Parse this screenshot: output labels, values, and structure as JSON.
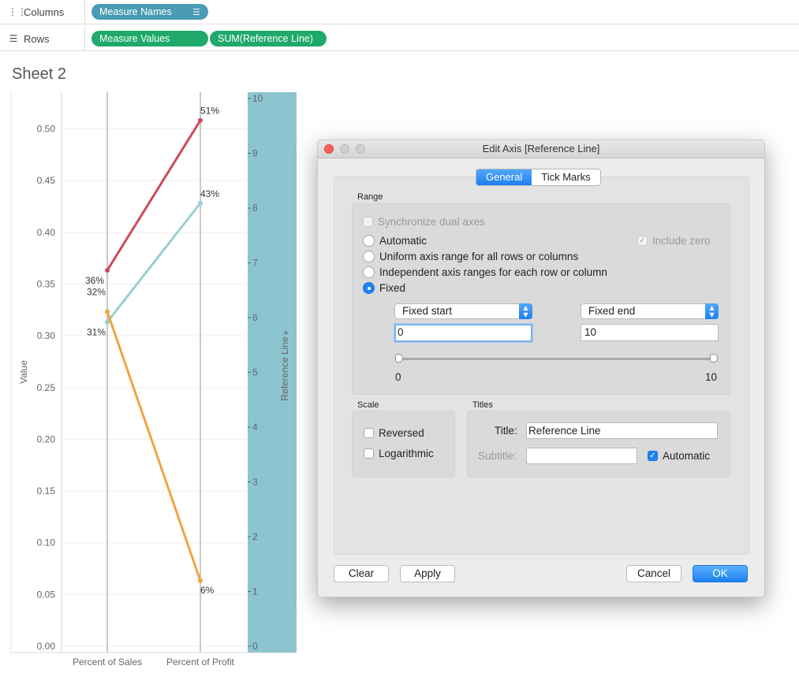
{
  "shelves": {
    "columns": {
      "label": "Columns",
      "icon": "columns-icon",
      "pills": [
        {
          "text": "Measure Names",
          "icon": "sort-icon"
        }
      ]
    },
    "rows": {
      "label": "Rows",
      "icon": "rows-icon",
      "pills": [
        {
          "text": "Measure Values"
        },
        {
          "text": "SUM(Reference Line)"
        }
      ]
    }
  },
  "sheet_title": "Sheet 2",
  "colors": {
    "pill_blue": "#4a9bb4",
    "pill_green": "#1fa96a",
    "series_red": "#d04a57",
    "series_teal": "#98cfce",
    "series_orange": "#f0a444",
    "ref_band": "#8cc4d0",
    "accent_blue": "#1f82f2"
  },
  "chart_data": {
    "type": "line",
    "categories": [
      "Percent of Sales",
      "Percent of Profit"
    ],
    "series": [
      {
        "values": [
          0.3633,
          0.5082
        ],
        "labels": [
          "36%",
          "51%"
        ],
        "color": "#d04a57"
      },
      {
        "values": [
          0.3133,
          0.4282
        ],
        "labels": [
          "31%",
          "43%"
        ],
        "color": "#98cfce"
      },
      {
        "values": [
          0.3233,
          0.0633
        ],
        "labels": [
          "32%",
          "6%"
        ],
        "color": "#f0a444"
      }
    ],
    "ylabel": "Value",
    "ylim": [
      0,
      0.5
    ],
    "yticks": [
      "0.00",
      "0.05",
      "0.10",
      "0.15",
      "0.20",
      "0.25",
      "0.30",
      "0.35",
      "0.40",
      "0.45",
      "0.50"
    ],
    "y2label": "Reference Line",
    "y2lim": [
      0,
      10
    ],
    "y2ticks": [
      "0",
      "1",
      "2",
      "3",
      "4",
      "5",
      "6",
      "7",
      "8",
      "9",
      "10"
    ],
    "grid": true
  },
  "dialog": {
    "title": "Edit Axis [Reference Line]",
    "tabs": [
      "General",
      "Tick Marks"
    ],
    "range": {
      "title": "Range",
      "sync_label": "Synchronize dual axes",
      "include_zero_label": "Include zero",
      "options": [
        "Automatic",
        "Uniform axis range for all rows or columns",
        "Independent axis ranges for each row or column",
        "Fixed"
      ],
      "selected": "Fixed",
      "fixed_start_select": "Fixed start",
      "fixed_end_select": "Fixed end",
      "start_value": "0",
      "end_value": "10",
      "slider_min_label": "0",
      "slider_max_label": "10"
    },
    "scale": {
      "title": "Scale",
      "reversed_label": "Reversed",
      "log_label": "Logarithmic"
    },
    "titles": {
      "title": "Titles",
      "title_label": "Title:",
      "title_value": "Reference Line",
      "subtitle_label": "Subtitle:",
      "subtitle_value": "",
      "automatic_label": "Automatic"
    },
    "buttons": {
      "clear": "Clear",
      "apply": "Apply",
      "cancel": "Cancel",
      "ok": "OK"
    }
  }
}
